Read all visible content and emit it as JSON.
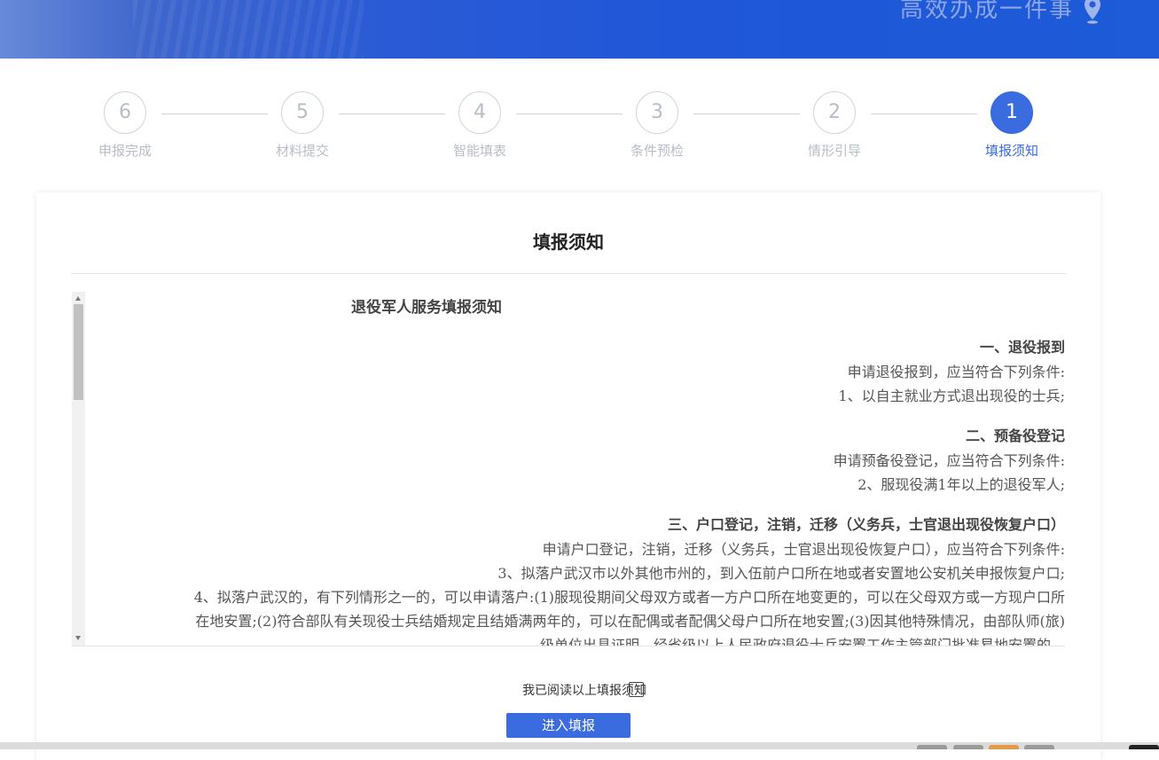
{
  "header": {
    "slogan": "高效办成一件事",
    "location_icon": "map-pin-icon",
    "colors": {
      "band": "#1f57d8",
      "accent": "#3a6bdf"
    }
  },
  "steps": [
    {
      "num": "1",
      "label": "填报须知",
      "active": true
    },
    {
      "num": "2",
      "label": "情形引导",
      "active": false
    },
    {
      "num": "3",
      "label": "条件预检",
      "active": false
    },
    {
      "num": "4",
      "label": "智能填表",
      "active": false
    },
    {
      "num": "5",
      "label": "材料提交",
      "active": false
    },
    {
      "num": "6",
      "label": "申报完成",
      "active": false
    }
  ],
  "card": {
    "title": "填报须知",
    "notice": {
      "title": "退役军人服务填报须知",
      "sections": [
        {
          "heading": "一、退役报到",
          "lines": [
            "申请退役报到，应当符合下列条件:",
            "1、以自主就业方式退出现役的士兵;"
          ]
        },
        {
          "heading": "二、预备役登记",
          "lines": [
            "申请预备役登记，应当符合下列条件:",
            "2、服现役满1年以上的退役军人;"
          ]
        },
        {
          "heading": "三、户口登记，注销，迁移（义务兵，士官退出现役恢复户口）",
          "lines": [
            "申请户口登记，注销，迁移（义务兵，士官退出现役恢复户口），应当符合下列条件:",
            "3、拟落户武汉市以外其他市州的，到入伍前户口所在地或者安置地公安机关申报恢复户口;",
            "4、拟落户武汉的，有下列情形之一的，可以申请落户:(1)服现役期间父母双方或者一方户口所在地变更的，可以在父母双方或一方现户口所",
            "在地安置;(2)符合部队有关现役士兵结婚规定且结婚满两年的，可以在配偶或者配偶父母户口所在地安置;(3)因其他特殊情况，由部队师(旅)",
            "级单位出具证明，经省级以上人民政府退役士兵安置工作主管部门批准易地安置的。"
          ]
        }
      ]
    },
    "agree_label": "我已阅读以上填报须知",
    "agree_checked": false,
    "enter_button": "进入填报"
  }
}
